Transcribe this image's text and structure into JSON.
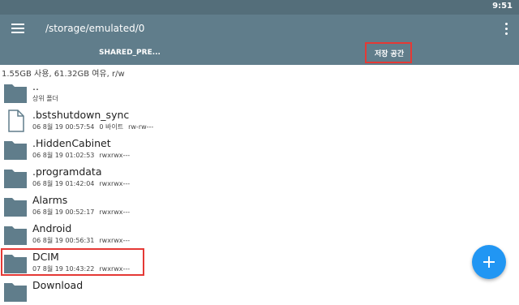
{
  "status_bar": {
    "time": "9:51"
  },
  "app_bar": {
    "path": "/storage/emulated/0"
  },
  "tabs": [
    {
      "label": "SHARED_PRE..."
    },
    {
      "label": "저장 공간"
    }
  ],
  "storage_info": "1.55GB 사용, 61.32GB 여유, r/w",
  "files": [
    {
      "name": "..",
      "date": "상위 폴더",
      "size": "",
      "perms": "",
      "icon": "folder-icon"
    },
    {
      "name": ".bstshutdown_sync",
      "date": "06 8월 19 00:57:54",
      "size": "0 바이트",
      "perms": "rw-rw---",
      "icon": "file-icon"
    },
    {
      "name": ".HiddenCabinet",
      "date": "06 8월 19 01:02:53",
      "size": "",
      "perms": "rwxrwx---",
      "icon": "folder-icon"
    },
    {
      "name": ".programdata",
      "date": "06 8월 19 01:42:04",
      "size": "",
      "perms": "rwxrwx---",
      "icon": "folder-icon"
    },
    {
      "name": "Alarms",
      "date": "06 8월 19 00:52:17",
      "size": "",
      "perms": "rwxrwx---",
      "icon": "folder-icon"
    },
    {
      "name": "Android",
      "date": "06 8월 19 00:56:31",
      "size": "",
      "perms": "rwxrwx---",
      "icon": "folder-icon"
    },
    {
      "name": "DCIM",
      "date": "07 8월 19 10:43:22",
      "size": "",
      "perms": "rwxrwx---",
      "icon": "folder-icon"
    },
    {
      "name": "Download",
      "date": "",
      "size": "",
      "perms": "",
      "icon": "folder-icon"
    }
  ],
  "colors": {
    "status_bar": "#546e7a",
    "app_bar": "#607d8b",
    "folder": "#607d8b",
    "fab": "#2196f3",
    "highlight": "#e53935"
  }
}
